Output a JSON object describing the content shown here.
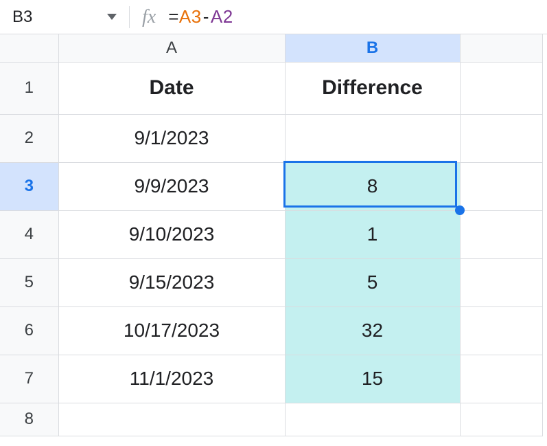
{
  "nameBox": "B3",
  "formula": {
    "eq": "=",
    "ref1": "A3",
    "op": "-",
    "ref2": "A2"
  },
  "cols": [
    "A",
    "B"
  ],
  "selectedCol": "B",
  "selectedRow": "3",
  "rows": [
    {
      "n": "1",
      "a": "Date",
      "b": "Difference",
      "header": true
    },
    {
      "n": "2",
      "a": "9/1/2023",
      "b": ""
    },
    {
      "n": "3",
      "a": "9/9/2023",
      "b": "8",
      "active": true,
      "fill": true
    },
    {
      "n": "4",
      "a": "9/10/2023",
      "b": "1",
      "fill": true
    },
    {
      "n": "5",
      "a": "9/15/2023",
      "b": "5",
      "fill": true
    },
    {
      "n": "6",
      "a": "10/17/2023",
      "b": "32",
      "fill": true
    },
    {
      "n": "7",
      "a": "11/1/2023",
      "b": "15",
      "fill": true
    },
    {
      "n": "8",
      "a": "",
      "b": ""
    }
  ]
}
